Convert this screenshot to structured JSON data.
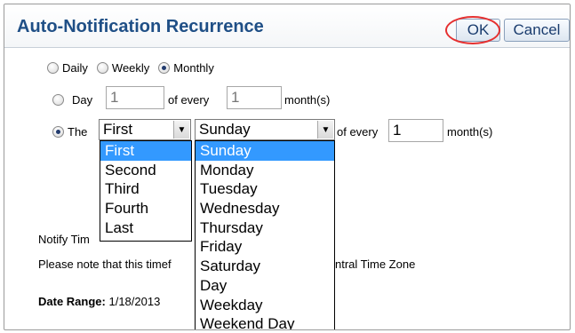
{
  "dialog": {
    "title": "Auto-Notification Recurrence",
    "ok_label": "OK",
    "cancel_label": "Cancel",
    "highlight_color": "#e53030"
  },
  "frequency": {
    "options": [
      "Daily",
      "Weekly",
      "Monthly"
    ],
    "selected": "Monthly"
  },
  "day_row": {
    "label": "Day",
    "day_value": "1",
    "of_every_label": "of every",
    "month_value": "1",
    "months_label": "month(s)"
  },
  "the_row": {
    "label": "The",
    "ordinal_selected": "First",
    "weekday_selected": "Sunday",
    "of_every_label": "of every",
    "month_value": "1",
    "months_label": "month(s)"
  },
  "ordinal_list": [
    "First",
    "Second",
    "Third",
    "Fourth",
    "Last"
  ],
  "weekday_list": [
    "Sunday",
    "Monday",
    "Tuesday",
    "Wednesday",
    "Thursday",
    "Friday",
    "Saturday",
    "Day",
    "Weekday",
    "Weekend Day"
  ],
  "notify_time_label": "Notify Tim",
  "note_text_left": "Please note that this timef",
  "note_text_right": "ntral Time Zone",
  "date_range": {
    "label": "Date Range:",
    "value": "1/18/2013"
  },
  "colors": {
    "title": "#1f4f86",
    "selection": "#3399ff"
  }
}
